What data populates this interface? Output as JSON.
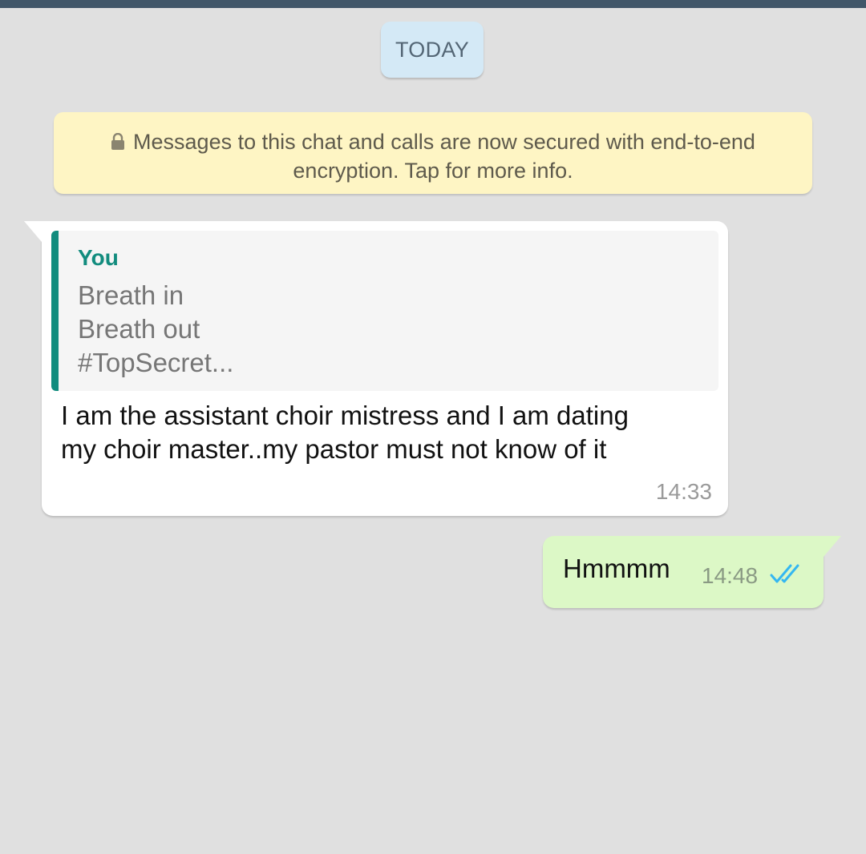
{
  "date_divider": "TODAY",
  "encryption_notice": {
    "line1": "Messages to this chat and calls are now secured with end-to-end",
    "line2": "encryption. Tap for more info.",
    "icon": "lock-icon"
  },
  "incoming_message": {
    "reply": {
      "author": "You",
      "lines": [
        "Breath in",
        "Breath out",
        "#TopSecret..."
      ]
    },
    "lines": [
      "I am the assistant choir mistress and I am dating",
      "my choir master..my pastor must not know of it"
    ],
    "time": "14:33"
  },
  "outgoing_message": {
    "text": "Hmmmm",
    "time": "14:48",
    "status_icon": "double-check-icon",
    "status_color": "#34b7f1"
  },
  "colors": {
    "top_bar": "#415669",
    "background": "#e0e0e0",
    "reply_accent": "#128c7e",
    "outgoing_bubble": "#dcf8c6",
    "banner": "#fef5c4",
    "date_chip": "#d4e9f6"
  }
}
